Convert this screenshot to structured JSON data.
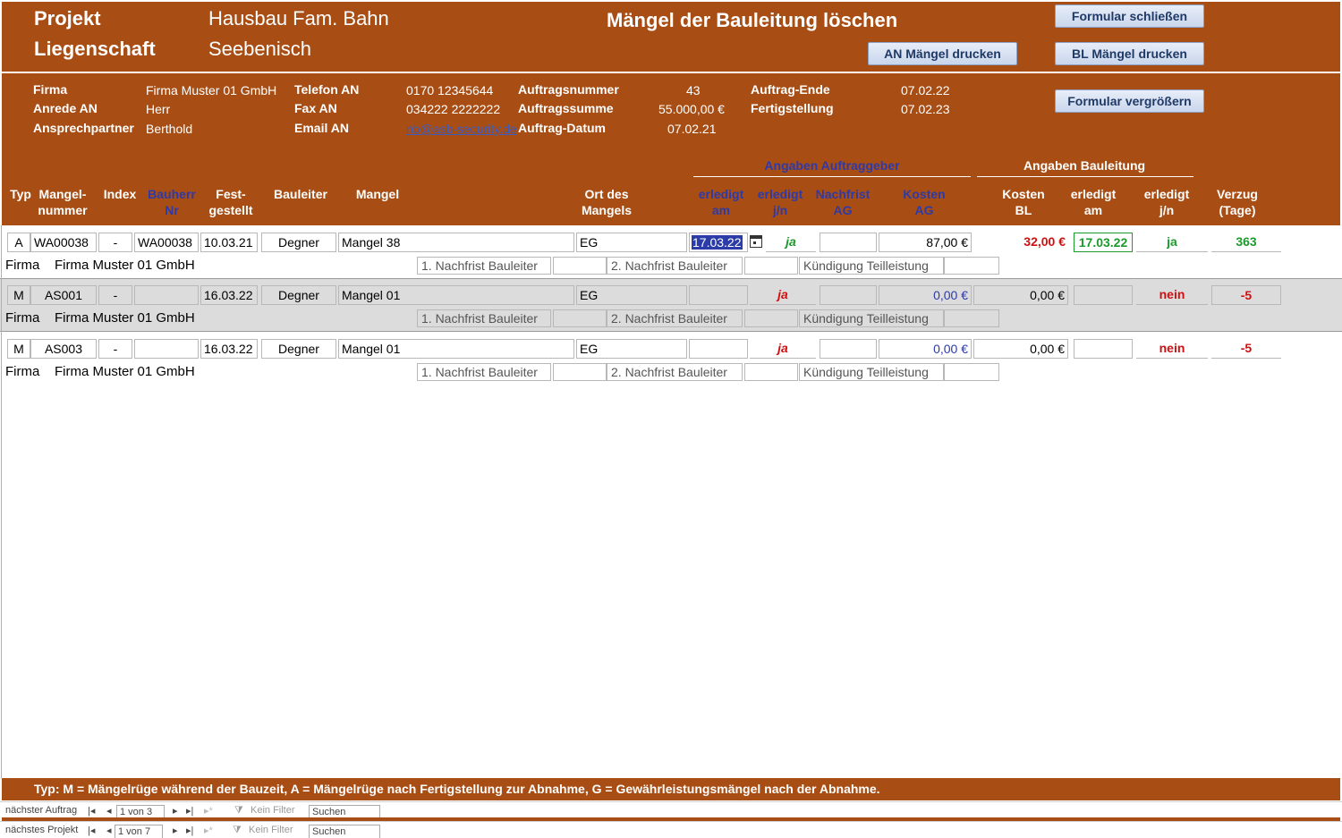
{
  "header": {
    "projekt_label": "Projekt",
    "projekt_value": "Hausbau Fam. Bahn",
    "liegenschaft_label": "Liegenschaft",
    "liegenschaft_value": "Seebenisch",
    "title": "Mängel der Bauleitung löschen",
    "btn_close": "Formular schließen",
    "btn_an_print": "AN Mängel drucken",
    "btn_bl_print": "BL Mängel drucken",
    "btn_enlarge": "Formular vergrößern"
  },
  "info": {
    "firma_label": "Firma",
    "firma_value": "Firma Muster 01 GmbH",
    "anrede_label": "Anrede AN",
    "anrede_value": "Herr",
    "ansprech_label": "Ansprechpartner",
    "ansprech_value": "Berthold",
    "telefon_label": "Telefon AN",
    "telefon_value": "0170 12345644",
    "fax_label": "Fax AN",
    "fax_value": "034222 2222222",
    "email_label": "Email AN",
    "email_value": "nb@asb-security.de",
    "auftragsnr_label": "Auftragsnummer",
    "auftragsnr_value": "43",
    "auftragssumme_label": "Auftragssumme",
    "auftragssumme_value": "55.000,00 €",
    "auftragdatum_label": "Auftrag-Datum",
    "auftragdatum_value": "07.02.21",
    "auftragende_label": "Auftrag-Ende",
    "auftragende_value": "07.02.22",
    "fertig_label": "Fertigstellung",
    "fertig_value": "07.02.23"
  },
  "columns": {
    "group_ag": "Angaben Auftraggeber",
    "group_bl": "Angaben Bauleitung",
    "typ": "Typ",
    "mangelnr_1": "Mangel-",
    "mangelnr_2": "nummer",
    "index": "Index",
    "bauherr_1": "Bauherr",
    "bauherr_2": "Nr",
    "fest_1": "Fest-",
    "fest_2": "gestellt",
    "bauleiter": "Bauleiter",
    "mangel": "Mangel",
    "ort_1": "Ort des",
    "ort_2": "Mangels",
    "erl_am_1": "erledigt",
    "erl_am_2": "am",
    "erl_jn_1": "erledigt",
    "erl_jn_2": "j/n",
    "nachfrist_1": "Nachfrist",
    "nachfrist_2": "AG",
    "kosten_ag_1": "Kosten",
    "kosten_ag_2": "AG",
    "kosten_bl_1": "Kosten",
    "kosten_bl_2": "BL",
    "bl_am_1": "erledigt",
    "bl_am_2": "am",
    "bl_jn_1": "erledigt",
    "bl_jn_2": "j/n",
    "verzug_1": "Verzug",
    "verzug_2": "(Tage)"
  },
  "rows": [
    {
      "typ": "A",
      "mangelnr": "WA00038",
      "index": "-",
      "bauherr": "WA00038",
      "festgestellt": "10.03.21",
      "bauleiter": "Degner",
      "mangel": "Mangel 38",
      "ort": "EG",
      "erl_am": "17.03.22",
      "erl_jn": "ja",
      "nachfrist": "",
      "kosten_ag": "87,00 €",
      "kosten_bl": "32,00 €",
      "bl_am": "17.03.22",
      "bl_jn": "ja",
      "verzug": "363",
      "firma_label": "Firma",
      "firma_value": "Firma Muster 01 GmbH",
      "nf1": "1. Nachfrist Bauleiter",
      "nf2": "2. Nachfrist Bauleiter",
      "kuend": "Kündigung Teilleistung"
    },
    {
      "typ": "M",
      "mangelnr": "AS001",
      "index": "-",
      "bauherr": "",
      "festgestellt": "16.03.22",
      "bauleiter": "Degner",
      "mangel": "Mangel 01",
      "ort": "EG",
      "erl_am": "",
      "erl_jn": "ja",
      "nachfrist": "",
      "kosten_ag": "0,00 €",
      "kosten_bl": "0,00 €",
      "bl_am": "",
      "bl_jn": "nein",
      "verzug": "-5",
      "firma_label": "Firma",
      "firma_value": "Firma Muster 01 GmbH",
      "nf1": "1. Nachfrist Bauleiter",
      "nf2": "2. Nachfrist Bauleiter",
      "kuend": "Kündigung Teilleistung"
    },
    {
      "typ": "M",
      "mangelnr": "AS003",
      "index": "-",
      "bauherr": "",
      "festgestellt": "16.03.22",
      "bauleiter": "Degner",
      "mangel": "Mangel 01",
      "ort": "EG",
      "erl_am": "",
      "erl_jn": "ja",
      "nachfrist": "",
      "kosten_ag": "0,00 €",
      "kosten_bl": "0,00 €",
      "bl_am": "",
      "bl_jn": "nein",
      "verzug": "-5",
      "firma_label": "Firma",
      "firma_value": "Firma Muster 01 GmbH",
      "nf1": "1. Nachfrist Bauleiter",
      "nf2": "2. Nachfrist Bauleiter",
      "kuend": "Kündigung Teilleistung"
    }
  ],
  "footer": {
    "legend": "Typ: M = Mängelrüge während der Bauzeit, A = Mängelrüge nach Fertigstellung zur Abnahme, G = Gewährleistungsmängel nach der Abnahme."
  },
  "nav1": {
    "label": "nächster Auftrag",
    "record": "1 von 3",
    "filter": "Kein Filter",
    "search": "Suchen"
  },
  "nav2": {
    "label": "nächstes Projekt",
    "record": "1 von 7",
    "filter": "Kein Filter",
    "search": "Suchen"
  },
  "colors": {
    "brown": "#a84e14",
    "green": "#1a9a2a",
    "red": "#d01010",
    "blue": "#2e3aa8"
  }
}
